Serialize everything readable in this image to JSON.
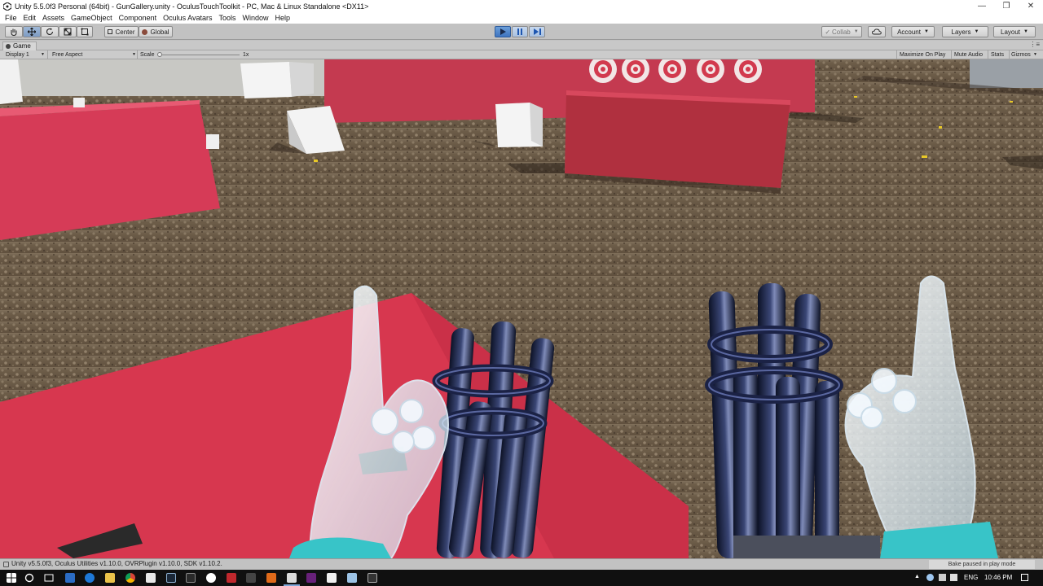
{
  "window": {
    "title": "Unity 5.5.0f3 Personal (64bit) - GunGallery.unity - OculusTouchToolkit - PC, Mac & Linux Standalone <DX11>",
    "controls": [
      "minimize-icon",
      "restore-icon",
      "close-icon"
    ]
  },
  "menu": {
    "items": [
      "File",
      "Edit",
      "Assets",
      "GameObject",
      "Component",
      "Oculus Avatars",
      "Tools",
      "Window",
      "Help"
    ]
  },
  "toolbar": {
    "tools": [
      "hand-tool-icon",
      "move-tool-icon",
      "rotate-tool-icon",
      "scale-tool-icon",
      "rect-tool-icon"
    ],
    "pivot_label": "Center",
    "space_label": "Global",
    "play_icons": [
      "play-icon",
      "pause-icon",
      "step-icon"
    ],
    "collab_label": "Collab",
    "account_label": "Account",
    "layers_label": "Layers",
    "layout_label": "Layout"
  },
  "game_tab": {
    "label": "Game"
  },
  "game_bar": {
    "display": "Display 1",
    "aspect": "Free Aspect",
    "scale_label": "Scale",
    "scale_value": "1x",
    "maximize_on_play": "Maximize On Play",
    "mute_audio": "Mute Audio",
    "stats": "Stats",
    "gizmos": "Gizmos"
  },
  "status": {
    "text": "Unity v5.5.0f3, Oculus Utilities v1.10.0, OVRPlugin v1.10.0, SDK v1.10.2.",
    "bake_text": "Bake paused in play mode"
  },
  "taskbar": {
    "language": "ENG",
    "time": "10:46 PM"
  },
  "colors": {
    "editor_gray": "#c2c2c2",
    "play_blue": "#3e74c0",
    "ground": "#6e5e4a",
    "red_walls": "#d63b57",
    "gun_metal": "#1c2340",
    "hand_ghost": "#e8f4ff",
    "cuff_cyan": "#39c8c8"
  }
}
